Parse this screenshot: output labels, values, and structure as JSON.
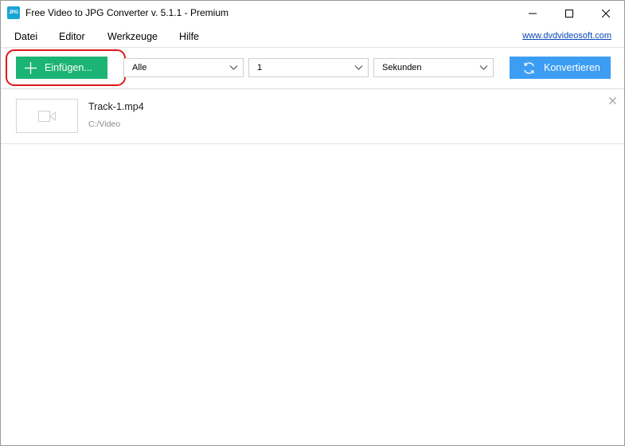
{
  "window": {
    "title": "Free Video to JPG Converter v. 5.1.1 - Premium",
    "icon_text": "JPG",
    "icon_name": "app-icon",
    "controls": [
      "minimize-icon",
      "maximize-icon",
      "close-icon"
    ]
  },
  "menu": {
    "items": [
      {
        "label": "Datei"
      },
      {
        "label": "Editor"
      },
      {
        "label": "Werkzeuge"
      },
      {
        "label": "Hilfe"
      }
    ],
    "site_link": "www.dvdvideosoft.com"
  },
  "toolbar": {
    "add_label": "Einfügen...",
    "add_icon": "plus-icon",
    "frames_select": {
      "value": "Alle"
    },
    "interval_select": {
      "value": "1"
    },
    "unit_select": {
      "value": "Sekunden"
    },
    "convert_label": "Konvertieren",
    "convert_icon": "refresh-icon"
  },
  "files": [
    {
      "name": "Track-1.mp4",
      "path": "C:/Video",
      "thumb_icon": "video-camera-icon",
      "remove_icon": "remove-icon"
    }
  ],
  "colors": {
    "add_button": "#1cb474",
    "convert_button": "#3c9df3",
    "highlight_ring": "#e2161a",
    "link": "#0b47b8"
  }
}
